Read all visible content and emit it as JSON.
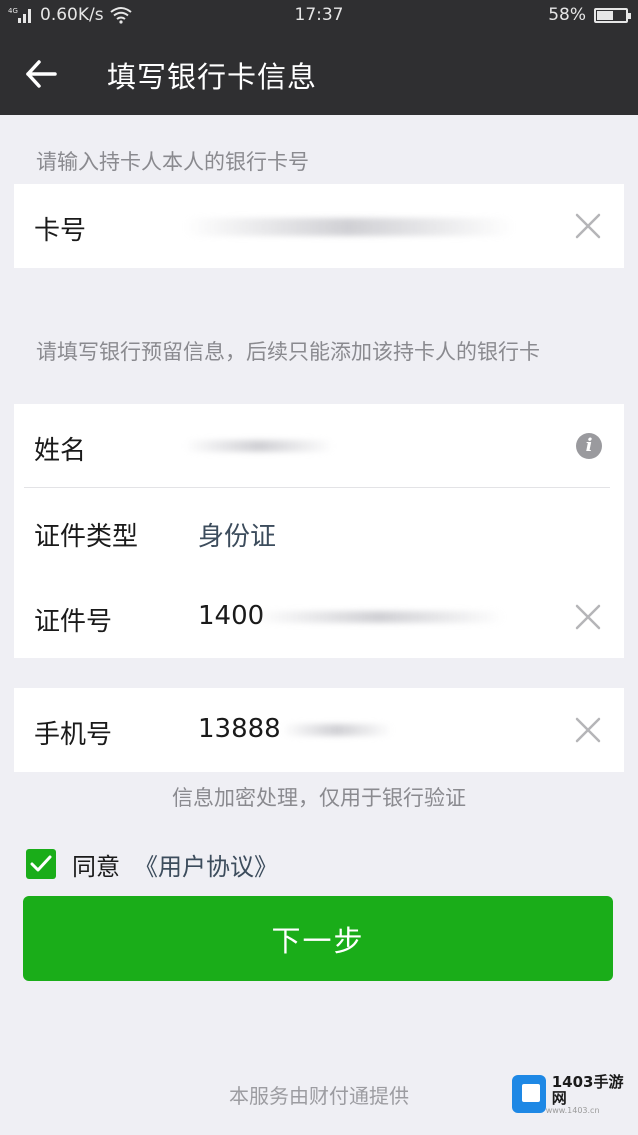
{
  "status_bar": {
    "network": "4G",
    "speed": "0.60K/s",
    "time": "17:37",
    "battery": "58%",
    "battery_level": 0.58
  },
  "nav": {
    "title": "填写银行卡信息"
  },
  "card_section": {
    "hint": "请输入持卡人本人的银行卡号",
    "card_number_label": "卡号"
  },
  "info_section": {
    "hint": "请填写银行预留信息，后续只能添加该持卡人的银行卡",
    "name_label": "姓名",
    "id_type_label": "证件类型",
    "id_type_value": "身份证",
    "id_number_label": "证件号",
    "id_number_value": "1400"
  },
  "phone_section": {
    "phone_label": "手机号",
    "phone_value": "13888"
  },
  "encrypt_note": "信息加密处理，仅用于银行验证",
  "agreement": {
    "agree_text": "同意",
    "link_text": "《用户协议》",
    "checked": true
  },
  "next_button": "下一步",
  "provider_note": "本服务由财付通提供",
  "watermark": {
    "brand": "1403手游网",
    "sub": "www.1403.cn"
  },
  "colors": {
    "accent": "#1aad19",
    "nav_bg": "#2f2f31",
    "page_bg": "#efeff4"
  }
}
